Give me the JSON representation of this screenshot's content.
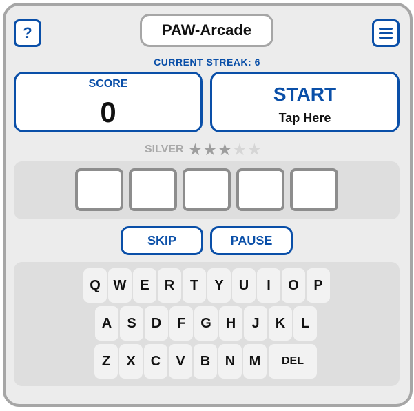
{
  "header": {
    "title": "PAW-Arcade",
    "help_label": "?"
  },
  "streak_text": "CURRENT STREAK: 6",
  "score": {
    "label": "SCORE",
    "value": "0"
  },
  "start": {
    "label": "START",
    "sub_label": "Tap Here"
  },
  "rank": {
    "label": "SILVER",
    "stars_filled": 3,
    "stars_total": 5
  },
  "tiles": [
    "",
    "",
    "",
    "",
    ""
  ],
  "controls": {
    "skip_label": "SKIP",
    "pause_label": "PAUSE"
  },
  "keyboard": {
    "row1": [
      "Q",
      "W",
      "E",
      "R",
      "T",
      "Y",
      "U",
      "I",
      "O",
      "P"
    ],
    "row2": [
      "A",
      "S",
      "D",
      "F",
      "G",
      "H",
      "J",
      "K",
      "L"
    ],
    "row3": [
      "Z",
      "X",
      "C",
      "V",
      "B",
      "N",
      "M"
    ],
    "delete_label": "DEL"
  },
  "colors": {
    "accent": "#0a4fa8",
    "frame": "#a6a6a6",
    "panel": "#dedede",
    "star_filled": "#9e9e9e",
    "star_empty": "#d6d6d6"
  },
  "icons": {
    "help": "question-mark-icon",
    "menu": "hamburger-menu-icon",
    "star": "star-icon"
  }
}
